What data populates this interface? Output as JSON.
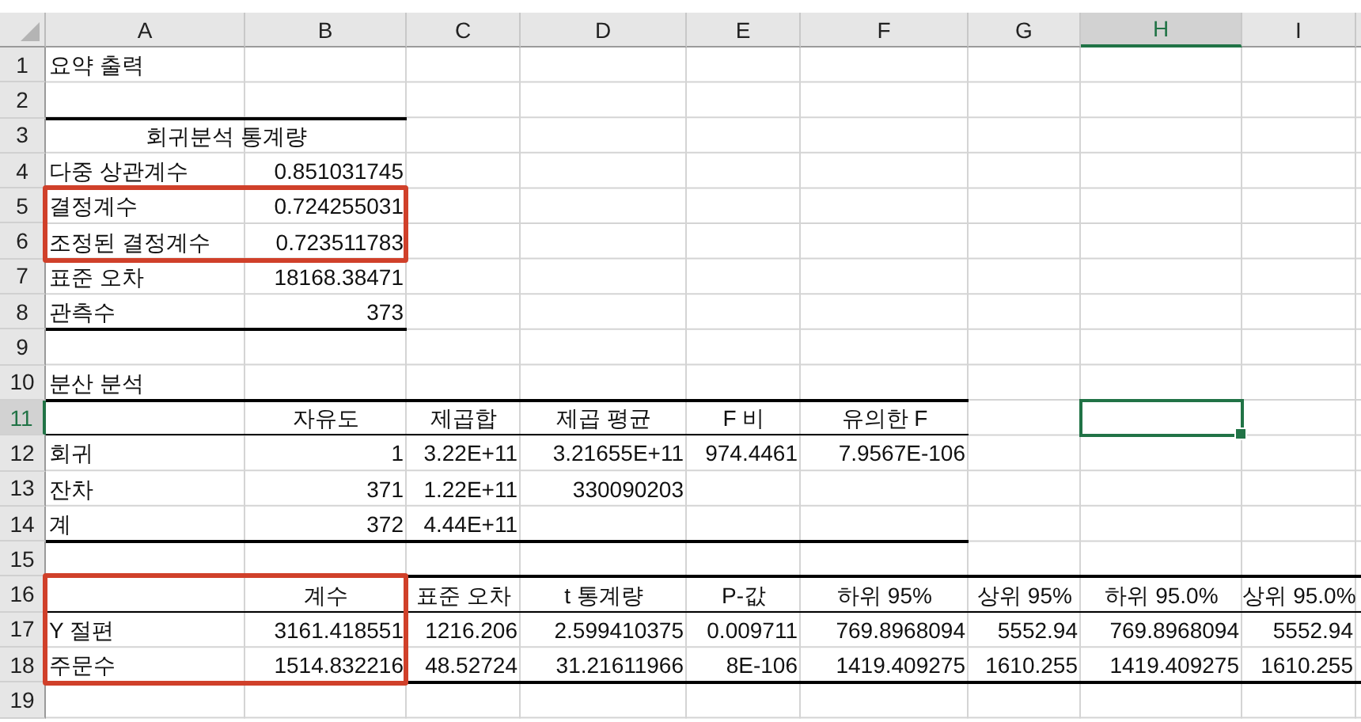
{
  "columns": [
    {
      "label": "A",
      "selected": false,
      "boxed": true
    },
    {
      "label": "B",
      "selected": false,
      "boxed": true
    },
    {
      "label": "C",
      "selected": false,
      "boxed": false
    },
    {
      "label": "D",
      "selected": false,
      "boxed": false
    },
    {
      "label": "E",
      "selected": false,
      "boxed": false
    },
    {
      "label": "F",
      "selected": false,
      "boxed": false
    },
    {
      "label": "G",
      "selected": false,
      "boxed": false
    },
    {
      "label": "H",
      "selected": true,
      "boxed": false
    },
    {
      "label": "I",
      "selected": false,
      "boxed": false
    }
  ],
  "rows": [
    {
      "label": "1",
      "selected": false,
      "kind": "title",
      "cells": [
        "요약 출력"
      ]
    },
    {
      "label": "2",
      "selected": false,
      "kind": "title",
      "cells": []
    },
    {
      "label": "3",
      "selected": false,
      "kind": "merged-heading",
      "thick_top": true,
      "cells": [
        "회귀분석 통계량",
        null
      ]
    },
    {
      "label": "4",
      "selected": false,
      "kind": "data",
      "cells": [
        "다중 상관계수",
        "0.851031745"
      ]
    },
    {
      "label": "5",
      "selected": false,
      "kind": "data",
      "boxed": true,
      "cells": [
        "결정계수",
        "0.724255031"
      ]
    },
    {
      "label": "6",
      "selected": false,
      "kind": "data",
      "boxed": true,
      "cells": [
        "조정된 결정계수",
        "0.723511783"
      ]
    },
    {
      "label": "7",
      "selected": false,
      "kind": "data",
      "cells": [
        "표준 오차",
        "18168.38471"
      ]
    },
    {
      "label": "8",
      "selected": false,
      "kind": "data",
      "thick_bottom": true,
      "cells": [
        "관측수",
        "373"
      ]
    },
    {
      "label": "9",
      "selected": false,
      "kind": "title",
      "cells": []
    },
    {
      "label": "10",
      "selected": false,
      "kind": "title",
      "cells": [
        "분산 분석"
      ]
    },
    {
      "label": "11",
      "selected": true,
      "kind": "header",
      "thick_top": true,
      "thin_bottom": true,
      "cells": [
        null,
        "자유도",
        "제곱합",
        "제곱 평균",
        "F 비",
        "유의한 F"
      ]
    },
    {
      "label": "12",
      "selected": false,
      "kind": "data",
      "cells": [
        "회귀",
        "1",
        "3.22E+11",
        "3.21655E+11",
        "974.4461",
        "7.9567E-106"
      ]
    },
    {
      "label": "13",
      "selected": false,
      "kind": "data",
      "cells": [
        "잔차",
        "371",
        "1.22E+11",
        "330090203"
      ]
    },
    {
      "label": "14",
      "selected": false,
      "kind": "data",
      "thick_bottom": true,
      "cells": [
        "계",
        "372",
        "4.44E+11",
        null,
        null,
        null
      ]
    },
    {
      "label": "15",
      "selected": false,
      "kind": "title",
      "cells": []
    },
    {
      "label": "16",
      "selected": false,
      "kind": "header",
      "boxed": true,
      "thick_top": true,
      "thin_bottom": true,
      "cells": [
        null,
        "계수",
        "표준 오차",
        "t 통계량",
        "P-값",
        "하위 95%",
        "상위 95%",
        "하위 95.0%",
        "상위 95.0%"
      ]
    },
    {
      "label": "17",
      "selected": false,
      "kind": "data",
      "boxed": true,
      "cells": [
        "Y 절편",
        "3161.418551",
        "1216.206",
        "2.599410375",
        "0.009711",
        "769.8968094",
        "5552.94",
        "769.8968094",
        "5552.94"
      ]
    },
    {
      "label": "18",
      "selected": false,
      "kind": "data",
      "boxed": true,
      "thick_bottom": true,
      "cells": [
        "주문수",
        "1514.832216",
        "48.52724",
        "31.21611966",
        "8E-106",
        "1419.409275",
        "1610.255",
        "1419.409275",
        "1610.255"
      ]
    },
    {
      "label": "19",
      "selected": false,
      "kind": "title",
      "cells": []
    }
  ]
}
